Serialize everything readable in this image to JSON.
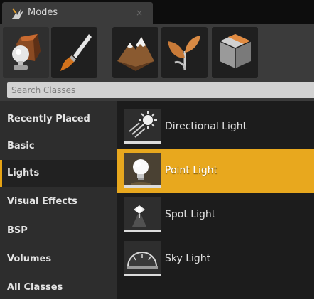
{
  "tab": {
    "title": "Modes",
    "close_glyph": "×",
    "icon": "modes-icon"
  },
  "modes": [
    {
      "name": "place-mode",
      "icon": "place-icon",
      "active": true
    },
    {
      "name": "paint-mode",
      "icon": "paint-brush-icon",
      "active": false
    },
    {
      "name": "landscape-mode",
      "icon": "landscape-icon",
      "active": false
    },
    {
      "name": "foliage-mode",
      "icon": "foliage-icon",
      "active": false
    },
    {
      "name": "geometry-mode",
      "icon": "geometry-icon",
      "active": false
    }
  ],
  "search": {
    "placeholder": "Search Classes"
  },
  "categories": [
    {
      "label": "Recently Placed",
      "active": false
    },
    {
      "label": "Basic",
      "active": false
    },
    {
      "label": "Lights",
      "active": true
    },
    {
      "label": "Visual Effects",
      "active": false
    },
    {
      "label": "BSP",
      "active": false
    },
    {
      "label": "Volumes",
      "active": false
    },
    {
      "label": "All Classes",
      "active": false
    }
  ],
  "items": [
    {
      "label": "Directional Light",
      "icon": "directional-light-icon",
      "selected": false
    },
    {
      "label": "Point Light",
      "icon": "point-light-icon",
      "selected": true
    },
    {
      "label": "Spot Light",
      "icon": "spot-light-icon",
      "selected": false
    },
    {
      "label": "Sky Light",
      "icon": "sky-light-icon",
      "selected": false
    }
  ],
  "colors": {
    "accent": "#e6a314",
    "selected_row": "#e8a81e",
    "panel_bg": "#1b1b1b",
    "sidebar_bg": "#2d2d2d",
    "search_bg": "#d2d2d2"
  }
}
